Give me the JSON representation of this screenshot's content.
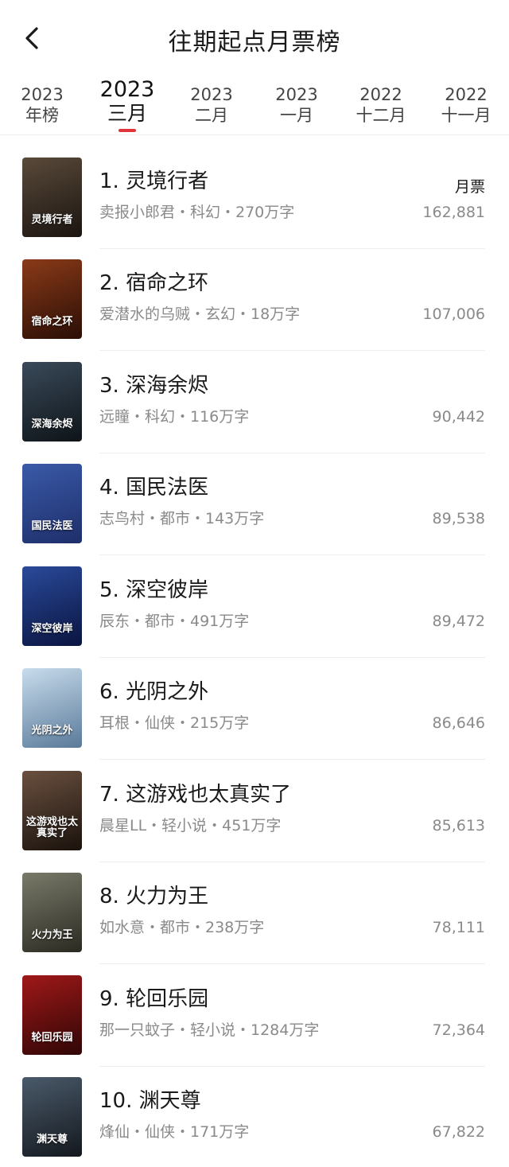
{
  "header": {
    "title": "往期起点月票榜",
    "back_icon": "chevron-left-icon"
  },
  "tabs": [
    {
      "year": "2023",
      "month": "年榜",
      "active": false
    },
    {
      "year": "2023",
      "month": "三月",
      "active": true
    },
    {
      "year": "2023",
      "month": "二月",
      "active": false
    },
    {
      "year": "2023",
      "month": "一月",
      "active": false
    },
    {
      "year": "2022",
      "month": "十二月",
      "active": false
    },
    {
      "year": "2022",
      "month": "十一月",
      "active": false
    }
  ],
  "accent_color": "#e0333c",
  "votes_label": "月票",
  "books": [
    {
      "title": "1. 灵境行者",
      "meta": "卖报小郎君・科幻・270万字",
      "votes": "162,881",
      "cover_text": "灵境行者",
      "cover_colors": [
        "#5a4a3a",
        "#1a1410"
      ]
    },
    {
      "title": "2. 宿命之环",
      "meta": "爱潜水的乌贼・玄幻・18万字",
      "votes": "107,006",
      "cover_text": "宿命之环",
      "cover_colors": [
        "#8a3a18",
        "#2a0e06"
      ]
    },
    {
      "title": "3. 深海余烬",
      "meta": "远瞳・科幻・116万字",
      "votes": "90,442",
      "cover_text": "深海余烬",
      "cover_colors": [
        "#3a4a5a",
        "#0e1418"
      ]
    },
    {
      "title": "4. 国民法医",
      "meta": "志鸟村・都市・143万字",
      "votes": "89,538",
      "cover_text": "国民法医",
      "cover_colors": [
        "#3a5aa8",
        "#1e2e6a"
      ]
    },
    {
      "title": "5. 深空彼岸",
      "meta": "辰东・都市・491万字",
      "votes": "89,472",
      "cover_text": "深空彼岸",
      "cover_colors": [
        "#2a4a9a",
        "#0a1440"
      ]
    },
    {
      "title": "6. 光阴之外",
      "meta": "耳根・仙侠・215万字",
      "votes": "86,646",
      "cover_text": "光阴之外",
      "cover_colors": [
        "#c8dcec",
        "#5a7a9a"
      ]
    },
    {
      "title": "7. 这游戏也太真实了",
      "meta": "晨星LL・轻小说・451万字",
      "votes": "85,613",
      "cover_text": "这游戏也太真实了",
      "cover_colors": [
        "#6a5040",
        "#1a120c"
      ]
    },
    {
      "title": "8. 火力为王",
      "meta": "如水意・都市・238万字",
      "votes": "78,111",
      "cover_text": "火力为王",
      "cover_colors": [
        "#7a7a6a",
        "#2a2a22"
      ]
    },
    {
      "title": "9. 轮回乐园",
      "meta": "那一只蚊子・轻小说・1284万字",
      "votes": "72,364",
      "cover_text": "轮回乐园",
      "cover_colors": [
        "#a01818",
        "#300606"
      ]
    },
    {
      "title": "10. 渊天尊",
      "meta": "烽仙・仙侠・171万字",
      "votes": "67,822",
      "cover_text": "渊天尊",
      "cover_colors": [
        "#4a5a6a",
        "#14181e"
      ]
    }
  ]
}
